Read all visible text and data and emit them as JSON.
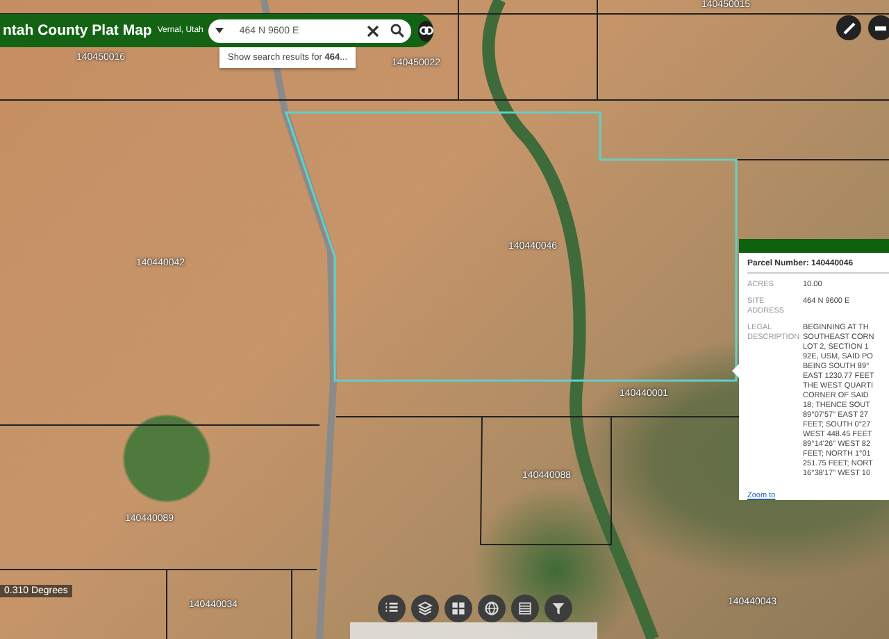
{
  "header": {
    "title": "ntah County Plat Map",
    "subtitle": "Vernal, Utah"
  },
  "search": {
    "value": "464 N 9600 E",
    "suggestion": "Show search results for **464**..."
  },
  "map": {
    "scale": "0.310 Degrees",
    "parcel_labels": [
      "140450015",
      "140450016",
      "140450022",
      "140440042",
      "140440046",
      "140440001",
      "140440088",
      "140440089",
      "140440034",
      "140440043"
    ]
  },
  "popup": {
    "title": "Parcel Number: 140440046",
    "fields": [
      {
        "label": "ACRES",
        "lines": [
          "10.00"
        ]
      },
      {
        "label": "SITE ADDRESS",
        "lines": [
          "464 N 9600 E"
        ]
      },
      {
        "label": "LEGAL DESCRIPTION",
        "lines": [
          "BEGINNING AT TH",
          "SOUTHEAST CORN",
          "LOT 2, SECTION 1",
          "92E, USM, SAID PO",
          "BEING SOUTH 89°",
          "EAST 1230.77 FEET",
          "THE WEST QUARTI",
          "CORNER OF SAID",
          "18; THENCE SOUT",
          "89°07'57\" EAST 27",
          "FEET; SOUTH 0°27",
          "WEST 448.45 FEET",
          "89°14'26\" WEST 82",
          "FEET; NORTH 1°01",
          "251.75 FEET; NORT",
          "16°38'17\" WEST 10"
        ]
      }
    ],
    "link": "Zoom to"
  },
  "toolbar": [
    {
      "kind": "list"
    },
    {
      "kind": "layers"
    },
    {
      "kind": "grid"
    },
    {
      "kind": "basemap"
    },
    {
      "kind": "table"
    },
    {
      "kind": "filter"
    }
  ]
}
